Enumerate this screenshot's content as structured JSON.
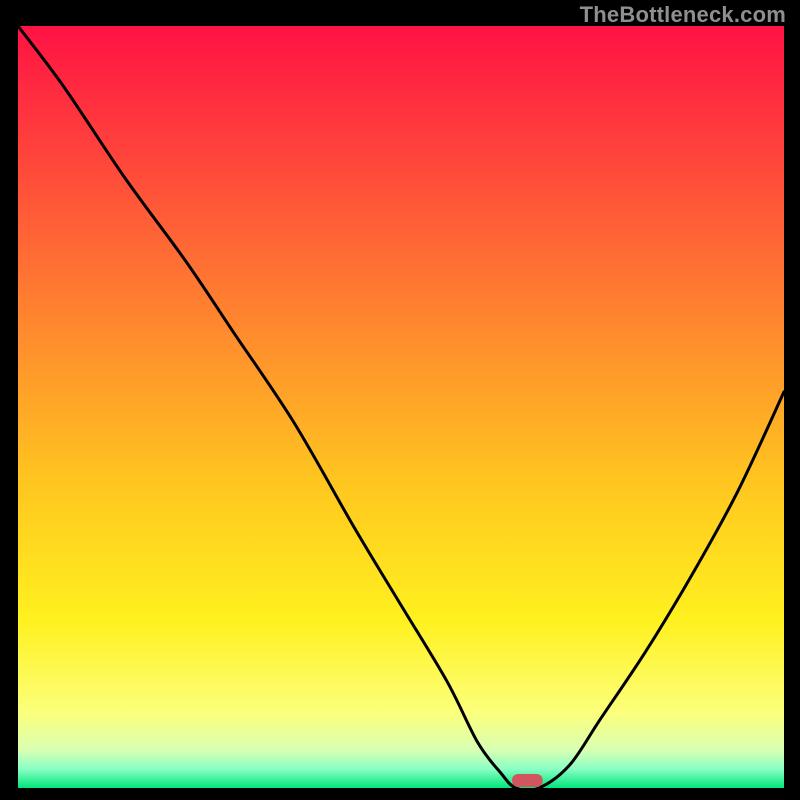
{
  "watermark": "TheBottleneck.com",
  "chart_data": {
    "type": "line",
    "title": "",
    "xlabel": "",
    "ylabel": "",
    "xlim": [
      0,
      100
    ],
    "ylim": [
      0,
      100
    ],
    "grid": false,
    "legend": false,
    "background_gradient": {
      "type": "vertical",
      "stops": [
        {
          "pos": 0.0,
          "color": "#ff1244"
        },
        {
          "pos": 0.2,
          "color": "#ff4d3a"
        },
        {
          "pos": 0.4,
          "color": "#ff8a2e"
        },
        {
          "pos": 0.6,
          "color": "#ffc61f"
        },
        {
          "pos": 0.78,
          "color": "#fff11f"
        },
        {
          "pos": 0.9,
          "color": "#fcff7a"
        },
        {
          "pos": 0.95,
          "color": "#d9ffb3"
        },
        {
          "pos": 0.975,
          "color": "#8affc4"
        },
        {
          "pos": 1.0,
          "color": "#00e57b"
        }
      ]
    },
    "series": [
      {
        "name": "bottleneck-curve",
        "color": "#000000",
        "x": [
          0,
          6,
          14,
          22,
          28,
          36,
          44,
          50,
          56,
          60,
          63,
          65,
          68,
          72,
          76,
          82,
          88,
          94,
          100
        ],
        "y": [
          100,
          92,
          80,
          69,
          60,
          48,
          34,
          24,
          14,
          6,
          2,
          0,
          0,
          3,
          9,
          18,
          28,
          39,
          52
        ]
      }
    ],
    "marker": {
      "name": "optimal-zone",
      "shape": "rounded-rect",
      "center_x": 66.5,
      "width": 4.0,
      "y": 0,
      "color": "#d1555e"
    }
  },
  "colors": {
    "page_bg": "#000000",
    "watermark": "#8f8f8f",
    "curve": "#000000",
    "marker": "#d1555e"
  }
}
